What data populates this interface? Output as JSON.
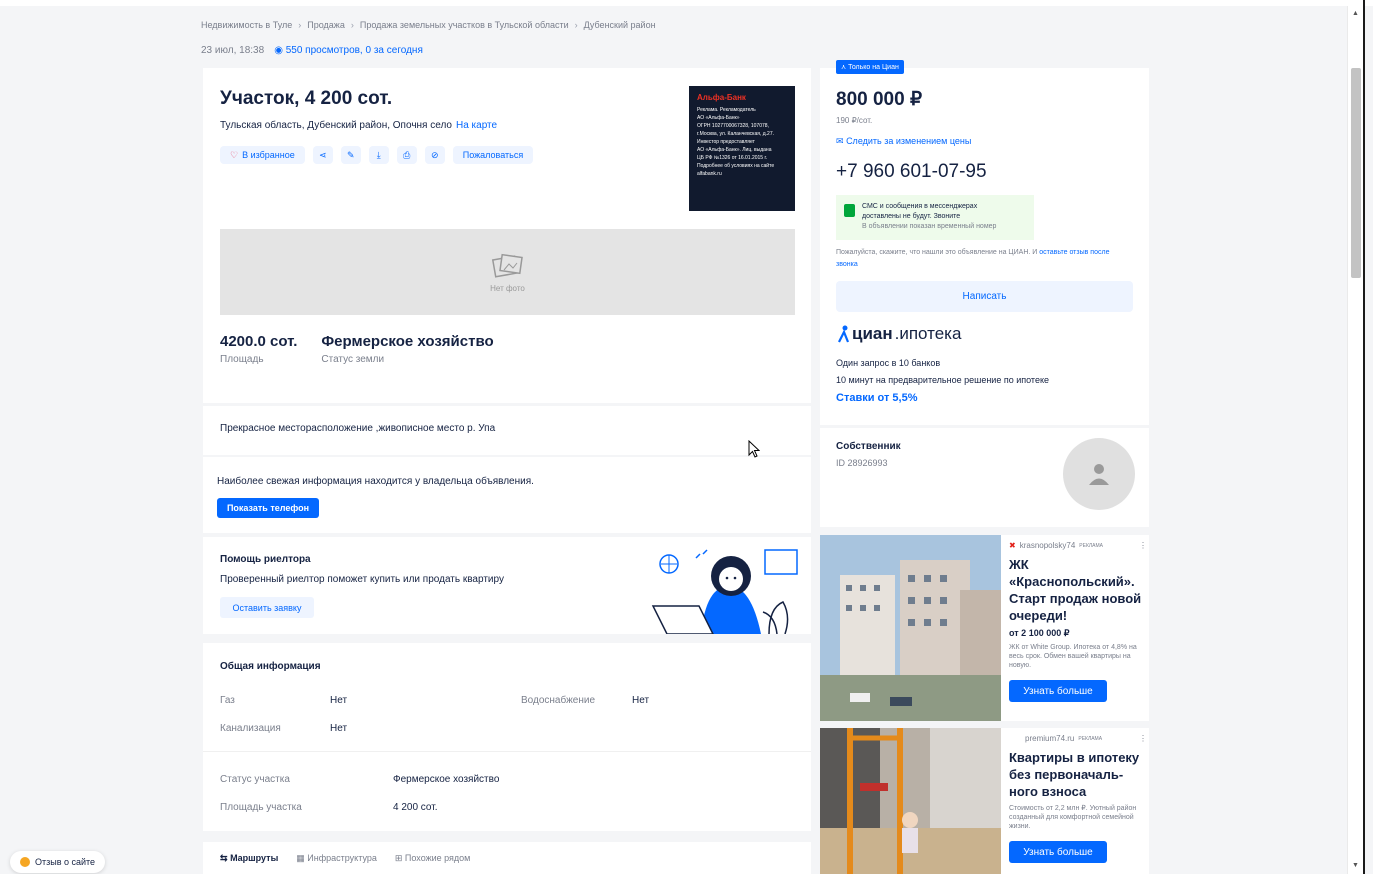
{
  "breadcrumbs": [
    "Недвижимость в Туле",
    "Продажа",
    "Продажа земельных участков в Тульской области",
    "Дубенский район"
  ],
  "meta": {
    "date": "23 июл, 18:38",
    "views": "550 просмотров, 0 за сегодня"
  },
  "listing": {
    "title": "Участок, 4 200 сот.",
    "address": "Тульская область, Дубенский район, Опочня село",
    "map_link": "На карте",
    "favorite_label": "В избранное",
    "complain_label": "Пожаловаться",
    "photo_placeholder": "Нет фото",
    "specs": [
      {
        "value": "4200.0 сот.",
        "label": "Площадь"
      },
      {
        "value": "Фермерское хозяйство",
        "label": "Статус земли"
      }
    ]
  },
  "bank_ad": {
    "logo": "Альфа-Банк",
    "lines": [
      "Реклама. Рекламодатель",
      "АО «Альфа-Банк»",
      "ОГРН 1027700067328, 107078,",
      "г.Москва, ул. Каланчевская, д.27.",
      "Инвестор предоставляет",
      "АО «Альфа-Банк». Лиц. выдана",
      "ЦБ РФ №1326 от 16.01.2015 г.",
      "Подробнее об условиях на сайте",
      "alfabank.ru"
    ]
  },
  "description": "Прекрасное месторасположение ,живописное место р. Упа",
  "contact_info": {
    "text": "Наиболее свежая информация находится у владельца объявления.",
    "button": "Показать телефон"
  },
  "realtor": {
    "title": "Помощь риелтора",
    "text": "Проверенный риелтор поможет купить или продать квартиру",
    "button": "Оставить заявку"
  },
  "general": {
    "title": "Общая информация",
    "gas_label": "Газ",
    "gas_value": "Нет",
    "water_label": "Водоснабжение",
    "water_value": "Нет",
    "sewer_label": "Канализация",
    "sewer_value": "Нет",
    "status_label": "Статус участка",
    "status_value": "Фермерское хозяйство",
    "area_label": "Площадь участка",
    "area_value": "4 200 сот."
  },
  "tabs": [
    "Маршруты",
    "Инфраструктура",
    "Похожие рядом"
  ],
  "price_card": {
    "badge": "Только на Циан",
    "price": "800 000 ₽",
    "per_unit": "190 ₽/сот.",
    "watch_label": "Следить за изменением цены",
    "phone": "+7 960 601-07-95",
    "notice_line1": "СМС и сообщения в мессенджерах",
    "notice_line2": "доставлены не будут. Звоните",
    "notice_sub": "В объявлении показан временный номер",
    "hint": "Пожалуйста, скажите, что нашли это объявление на ЦИАН. И ",
    "hint_link": "оставьте отзыв после звонка",
    "write_button": "Написать",
    "cian_brand": "циан",
    "cian_product": ".ипотека",
    "cian_line1": "Один запрос в 10 банков",
    "cian_line2": "10 минут на предварительное решение по ипотеке",
    "cian_rates": "Ставки от 5,5%"
  },
  "owner": {
    "name": "Собственник",
    "id": "ID 28926993"
  },
  "ads": [
    {
      "source": "krasnopolsky74",
      "tag": "РЕКЛАМА",
      "title": "ЖК «Краснопольский». Старт продаж новой очереди!",
      "price": "от 2 100 000 ₽",
      "desc": "ЖК от White Group. Ипотека от 4,8% на весь срок. Обмен вашей квартиры на новую.",
      "button": "Узнать больше"
    },
    {
      "source": "premium74.ru",
      "tag": "РЕКЛАМА",
      "title": "Квартиры в ипотеку без первоначаль-ного взноса",
      "desc": "Стоимость от 2,2 млн ₽. Уютный район созданный для комфортной семейной жизни.",
      "button": "Узнать больше"
    }
  ],
  "feedback": "Отзыв о сайте",
  "colors": {
    "accent": "#0468ff",
    "text": "#152242",
    "muted": "#7a7f8c",
    "success": "#00a63b"
  }
}
